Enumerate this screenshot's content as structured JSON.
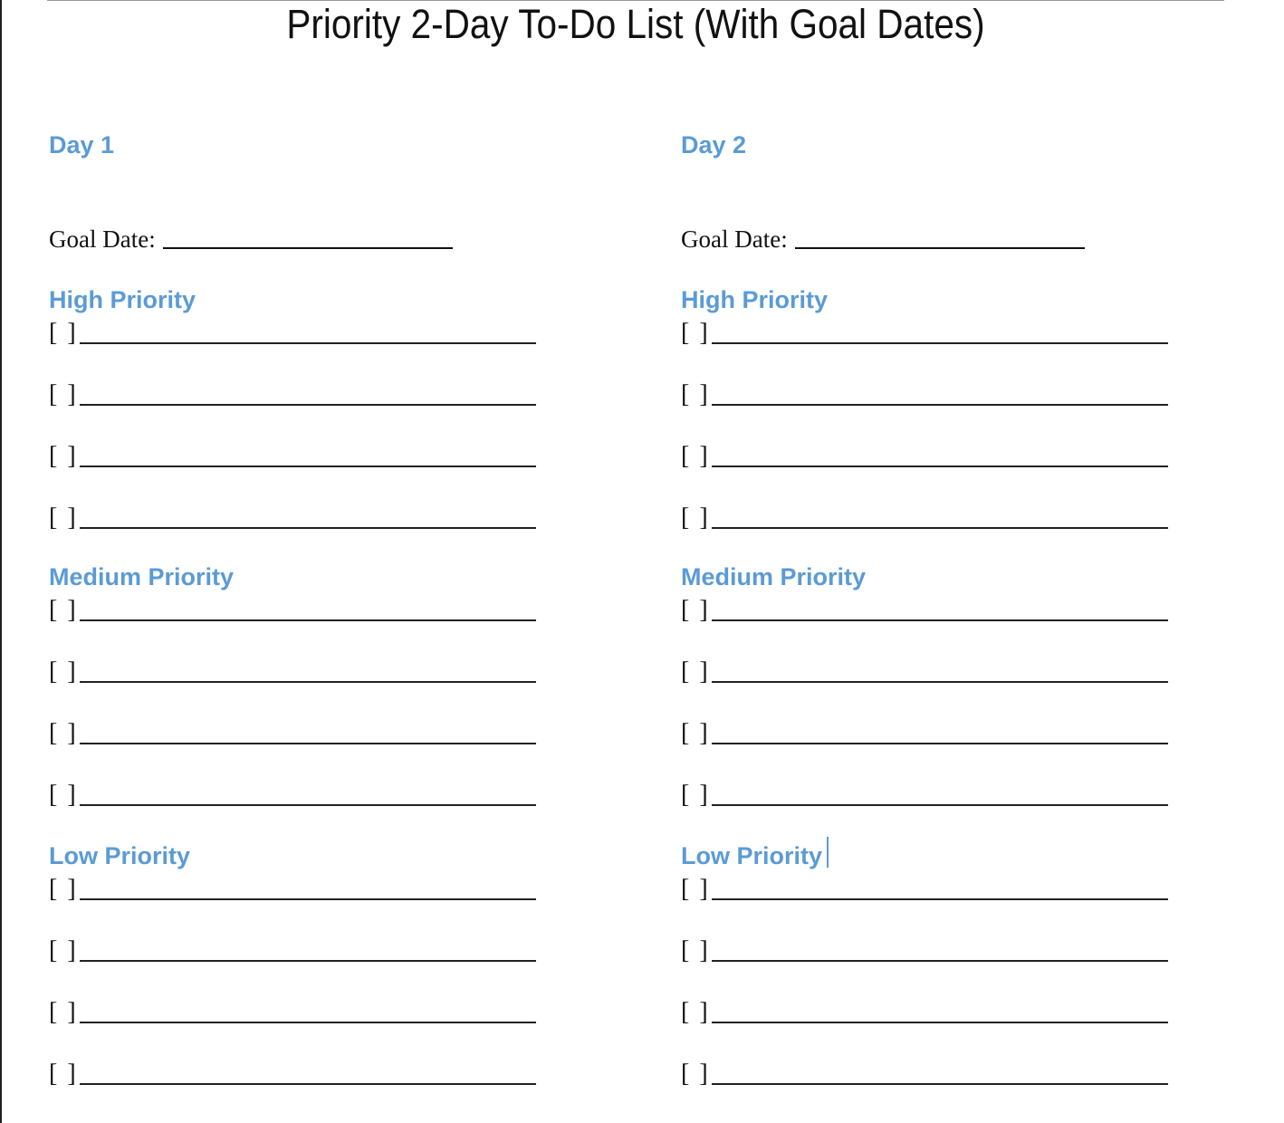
{
  "document": {
    "title": "Priority 2-Day To-Do List (With Goal Dates)",
    "accent_color": "#5B9BD5",
    "checkbox_glyph": "[ ]",
    "days": [
      {
        "heading": "Day 1",
        "goal_date_label": "Goal Date:",
        "goal_date_value": "",
        "sections": [
          {
            "heading": "High Priority",
            "tasks": [
              "",
              "",
              "",
              ""
            ]
          },
          {
            "heading": "Medium Priority",
            "tasks": [
              "",
              "",
              "",
              ""
            ]
          },
          {
            "heading": "Low Priority",
            "tasks": [
              "",
              "",
              "",
              ""
            ]
          }
        ]
      },
      {
        "heading": "Day 2",
        "goal_date_label": "Goal Date:",
        "goal_date_value": "",
        "sections": [
          {
            "heading": "High Priority",
            "tasks": [
              "",
              "",
              "",
              ""
            ]
          },
          {
            "heading": "Medium Priority",
            "tasks": [
              "",
              "",
              "",
              ""
            ]
          },
          {
            "heading": "Low Priority",
            "tasks": [
              "",
              "",
              "",
              ""
            ]
          }
        ]
      }
    ]
  }
}
